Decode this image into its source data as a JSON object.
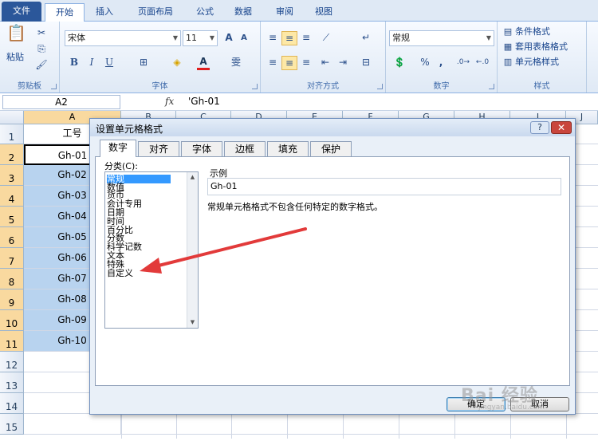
{
  "ribbon_tabs": [
    "文件",
    "开始",
    "插入",
    "页面布局",
    "公式",
    "数据",
    "审阅",
    "视图"
  ],
  "ribbon": {
    "clipboard": {
      "label": "剪贴板",
      "paste": "粘贴"
    },
    "font": {
      "label": "字体",
      "name": "宋体",
      "size": "11",
      "grow": "A",
      "shrink": "A",
      "bold": "B",
      "italic": "I",
      "underline": "U",
      "font_color_letter": "A",
      "phonetic": "雯"
    },
    "alignment": {
      "label": "对齐方式"
    },
    "number": {
      "label": "数字",
      "format": "常规",
      "percent": "%",
      "comma": ","
    },
    "styles": {
      "label": "样式",
      "conditional": "条件格式",
      "table": "套用表格格式",
      "cell_styles": "单元格样式"
    }
  },
  "formula_bar": {
    "name_box": "A2",
    "fx": "fx",
    "content": "'Gh-01"
  },
  "columns": [
    "A",
    "B",
    "C",
    "D",
    "E",
    "F",
    "G",
    "H",
    "I",
    "J"
  ],
  "rows": [
    "1",
    "2",
    "3",
    "4",
    "5",
    "6",
    "7",
    "8",
    "9",
    "10",
    "11",
    "12",
    "13",
    "14",
    "15"
  ],
  "cells_a": [
    "工号",
    "Gh-01",
    "Gh-02",
    "Gh-03",
    "Gh-04",
    "Gh-05",
    "Gh-06",
    "Gh-07",
    "Gh-08",
    "Gh-09",
    "Gh-10",
    "",
    "",
    "",
    ""
  ],
  "dialog": {
    "title": "设置单元格格式",
    "help": "?",
    "close": "✕",
    "tabs": [
      "数字",
      "对齐",
      "字体",
      "边框",
      "填充",
      "保护"
    ],
    "category_label": "分类(C):",
    "categories": [
      "常规",
      "数值",
      "货币",
      "会计专用",
      "日期",
      "时间",
      "百分比",
      "分数",
      "科学记数",
      "文本",
      "特殊",
      "自定义"
    ],
    "selected_category": "常规",
    "sample_label": "示例",
    "sample_value": "Gh-01",
    "description": "常规单元格格式不包含任何特定的数字格式。",
    "ok": "确定",
    "cancel": "取消"
  },
  "watermark": {
    "main": "Bai 经验",
    "sub": "jingyan.baidu.com"
  },
  "colors": {
    "selection": "#b8d3ef",
    "header_selected": "#f9d99f",
    "arrow": "#e23a3a",
    "file_tab": "#2b579a"
  }
}
